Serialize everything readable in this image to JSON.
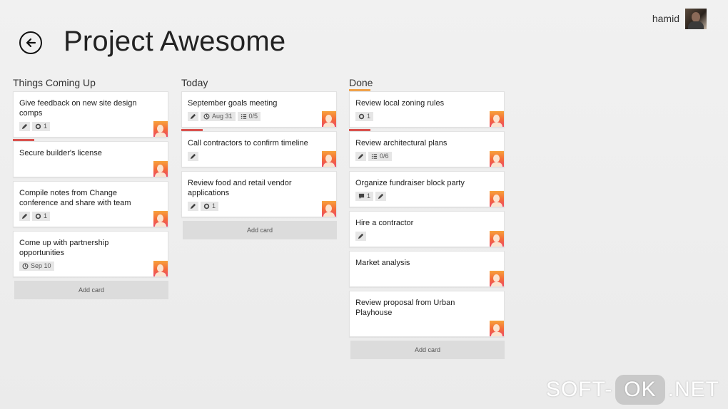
{
  "header": {
    "title": "Project Awesome",
    "back_icon": "arrow-left-circle-icon",
    "user_name": "hamid"
  },
  "colors": {
    "label_red": "#d9534f",
    "label_orange": "#f0a24b",
    "badge_bg": "#e6e6e6",
    "add_card_bg": "#dcdcdc"
  },
  "lists": [
    {
      "title": "Things Coming Up",
      "add_card_label": "Add card",
      "cards": [
        {
          "title": "Give feedback on new site design comps",
          "badges": [
            {
              "icon": "pencil-icon",
              "text": ""
            },
            {
              "icon": "attachment-icon",
              "text": "1"
            }
          ]
        },
        {
          "title": "Secure builder's license",
          "label": "red",
          "badges": []
        },
        {
          "title": "Compile notes from Change conference and share with team",
          "badges": [
            {
              "icon": "pencil-icon",
              "text": ""
            },
            {
              "icon": "attachment-icon",
              "text": "1"
            }
          ]
        },
        {
          "title": "Come up with partnership opportunities",
          "badges": [
            {
              "icon": "clock-icon",
              "text": "Sep 10"
            }
          ]
        }
      ]
    },
    {
      "title": "Today",
      "add_card_label": "Add card",
      "cards": [
        {
          "title": "September goals meeting",
          "badges": [
            {
              "icon": "pencil-icon",
              "text": ""
            },
            {
              "icon": "clock-icon",
              "text": "Aug 31"
            },
            {
              "icon": "checklist-icon",
              "text": "0/5"
            }
          ]
        },
        {
          "title": "Call contractors to confirm timeline",
          "label": "red",
          "badges": [
            {
              "icon": "pencil-icon",
              "text": ""
            }
          ]
        },
        {
          "title": "Review food and retail vendor applications",
          "badges": [
            {
              "icon": "pencil-icon",
              "text": ""
            },
            {
              "icon": "attachment-icon",
              "text": "1"
            }
          ]
        }
      ]
    },
    {
      "title": "Done",
      "add_card_label": "Add card",
      "cards": [
        {
          "title": "Review local zoning rules",
          "label": "orange",
          "badges": [
            {
              "icon": "attachment-icon",
              "text": "1"
            }
          ]
        },
        {
          "title": "Review architectural plans",
          "label": "red",
          "badges": [
            {
              "icon": "pencil-icon",
              "text": ""
            },
            {
              "icon": "checklist-icon",
              "text": "0/6"
            }
          ]
        },
        {
          "title": "Organize fundraiser block party",
          "badges": [
            {
              "icon": "comment-icon",
              "text": "1"
            },
            {
              "icon": "pencil-icon",
              "text": ""
            }
          ]
        },
        {
          "title": "Hire a contractor",
          "badges": [
            {
              "icon": "pencil-icon",
              "text": ""
            }
          ]
        },
        {
          "title": "Market analysis",
          "badges": []
        },
        {
          "title": "Review proposal from Urban Playhouse",
          "badges": []
        }
      ]
    }
  ],
  "watermark": {
    "left": "SOFT-",
    "middle": "OK",
    "right": ".NET"
  }
}
